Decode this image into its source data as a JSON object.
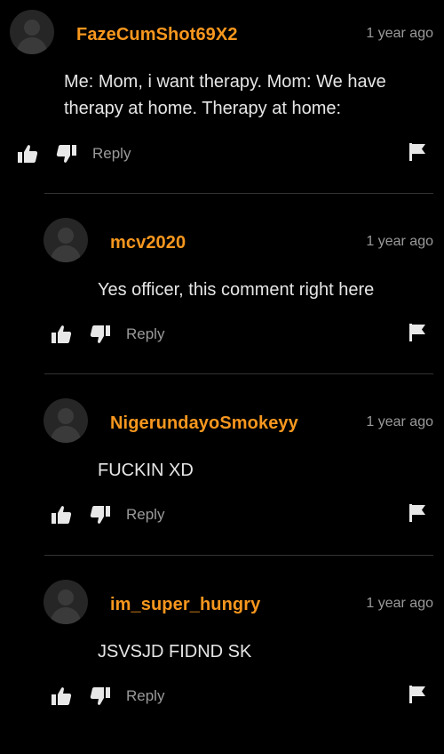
{
  "colors": {
    "background": "#000000",
    "username": "#f7971e",
    "text": "#e6e6e6",
    "muted": "#9a9a9a",
    "divider": "#333333"
  },
  "icons": {
    "avatar": "user-silhouette-icon",
    "like": "thumbs-up-icon",
    "dislike": "thumbs-down-icon",
    "flag": "flag-icon"
  },
  "comments": [
    {
      "username": "FazeCumShot69X2",
      "timestamp": "1 year ago",
      "body": "Me: Mom, i want therapy. Mom: We have therapy at home. Therapy at home:",
      "reply_label": "Reply"
    },
    {
      "username": "mcv2020",
      "timestamp": "1 year ago",
      "body": "Yes officer, this comment right here",
      "reply_label": "Reply"
    },
    {
      "username": "NigerundayoSmokeyy",
      "timestamp": "1 year ago",
      "body": "FUCKIN XD",
      "reply_label": "Reply"
    },
    {
      "username": "im_super_hungry",
      "timestamp": "1 year ago",
      "body": "JSVSJD FIDND SK",
      "reply_label": "Reply"
    }
  ]
}
